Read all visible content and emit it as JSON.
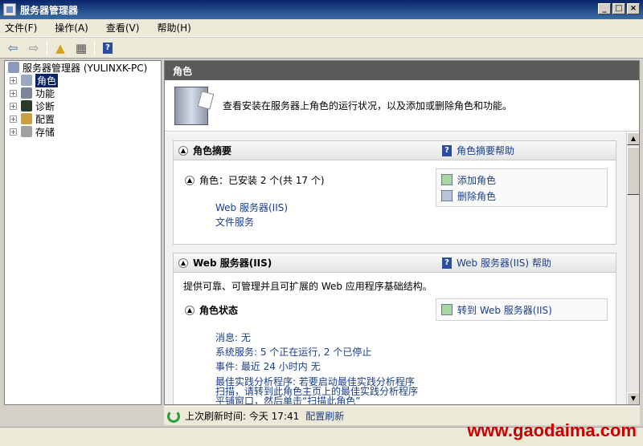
{
  "window": {
    "title": "服务器管理器"
  },
  "menu": [
    "文件(F)",
    "操作(A)",
    "查看(V)",
    "帮助(H)"
  ],
  "tree": {
    "root": "服务器管理器 (YULINXK-PC)",
    "items": [
      {
        "label": "角色",
        "icon": "roles-icon",
        "selected": true
      },
      {
        "label": "功能",
        "icon": "features-icon"
      },
      {
        "label": "诊断",
        "icon": "diagnostics-icon"
      },
      {
        "label": "配置",
        "icon": "configuration-icon"
      },
      {
        "label": "存储",
        "icon": "storage-icon"
      }
    ]
  },
  "right": {
    "header": "角色",
    "banner": "查看安装在服务器上角色的运行状况，以及添加或删除角色和功能。",
    "summary": {
      "title": "角色摘要",
      "help": "角色摘要帮助",
      "roles_label": "角色：已安装 2 个(共 17 个)",
      "installed": [
        "Web 服务器(IIS)",
        "文件服务"
      ],
      "actions": [
        "添加角色",
        "删除角色"
      ]
    },
    "web": {
      "title": "Web 服务器(IIS)",
      "help": "Web 服务器(IIS) 帮助",
      "desc": "提供可靠、可管理并且可扩展的 Web 应用程序基础结构。",
      "status_title": "角色状态",
      "goto": "转到 Web 服务器(IIS)",
      "msg": "消息: 无",
      "services": "系统服务: 5 个正在运行, 2 个已停止",
      "events": "事件: 最近 24 小时内 无",
      "bpa1": "最佳实践分析程序: 若要启动最佳实践分析程序",
      "bpa2": "扫描，请转到此角色主页上的最佳实践分析程序",
      "bpa3": "平铺窗口，然后单击“扫描此角色”"
    }
  },
  "status": {
    "last_refresh": "上次刷新时间: 今天 17:41",
    "refresh_link": "配置刷新"
  },
  "watermark": "www.gaodaima.com"
}
